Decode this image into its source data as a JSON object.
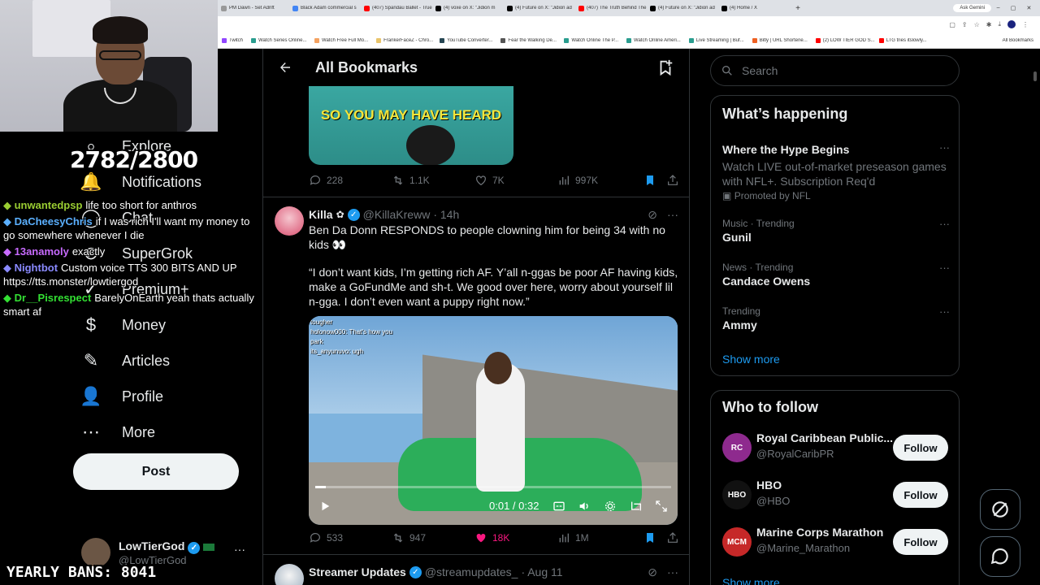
{
  "browser": {
    "tabs": [
      {
        "label": "PM Dawn - Set Adrift",
        "color": "#999"
      },
      {
        "label": "Black Adam commercial s",
        "color": "#4285f4"
      },
      {
        "label": "(407) Spandau Ballet - True",
        "color": "#ff0000"
      },
      {
        "label": "(4) voxe on X: \"Jidion m",
        "color": "#000000"
      },
      {
        "label": "(4) Future on X: \"Jidion ad",
        "color": "#000000"
      },
      {
        "label": "(407) The Truth Behind The",
        "color": "#ff0000"
      },
      {
        "label": "(4) Future on X: \"Jidion ad",
        "color": "#000000"
      },
      {
        "label": "(4) Home / X",
        "color": "#000000"
      }
    ],
    "new_tab": "+",
    "gemini": "Ask Gemini",
    "bookmarks": [
      {
        "label": "Twitch",
        "color": "#9146ff"
      },
      {
        "label": "Watch Series Online...",
        "color": "#2a9d8f"
      },
      {
        "label": "Watch Free Full Mo...",
        "color": "#f4a261"
      },
      {
        "label": "FrankerFaceZ - Chro...",
        "color": "#e9c46a"
      },
      {
        "label": "YouTube Converter...",
        "color": "#264653"
      },
      {
        "label": "Fear the Walking De...",
        "color": "#555555"
      },
      {
        "label": "Watch Online The P...",
        "color": "#2a9d8f"
      },
      {
        "label": "Watch Online Ameri...",
        "color": "#2a9d8f"
      },
      {
        "label": "Live Streaming | Buf...",
        "color": "#2a9d8f"
      },
      {
        "label": "Bitly | URL Shortene...",
        "color": "#ee6123"
      },
      {
        "label": "(2) LOW TIER GOD S...",
        "color": "#ff0000"
      },
      {
        "label": "LTG tries itslowly...",
        "color": "#ff0000"
      }
    ],
    "all_bookmarks": "All Bookmarks"
  },
  "nav": {
    "items": [
      {
        "label": "Explore",
        "icon": "search-icon",
        "glyph": "⌕"
      },
      {
        "label": "Notifications",
        "icon": "bell-icon",
        "glyph": "🔔"
      },
      {
        "label": "Chat",
        "icon": "chat-icon",
        "glyph": "◯"
      },
      {
        "label": "SuperGrok",
        "icon": "grok-icon",
        "glyph": "⊘"
      },
      {
        "label": "Premium+",
        "icon": "premium-icon",
        "glyph": "✓"
      },
      {
        "label": "Money",
        "icon": "money-icon",
        "glyph": "$"
      },
      {
        "label": "Articles",
        "icon": "articles-icon",
        "glyph": "✎"
      },
      {
        "label": "Profile",
        "icon": "profile-icon",
        "glyph": "👤"
      },
      {
        "label": "More",
        "icon": "more-icon",
        "glyph": "⋯"
      }
    ],
    "post_label": "Post",
    "account": {
      "name": "LowTierGod",
      "handle": "@LowTierGod",
      "more": "···"
    }
  },
  "overlay": {
    "counter": "2782/2800",
    "bans": "YEARLY BANS: 8041",
    "chat": [
      {
        "user": "unwantedpsp",
        "color": "#9acd32",
        "text": "life too short for anthros"
      },
      {
        "user": "DaCheesyChris",
        "color": "#5bb0ff",
        "text": "if I was rich I'll want my money to go somewhere whenever I die"
      },
      {
        "user": "13anamoly",
        "color": "#c86bff",
        "text": "exactly"
      },
      {
        "user": "Nightbot",
        "color": "#8a8aff",
        "text": "Custom voice TTS 300 BITS AND UP https://tts.monster/lowtiergod"
      },
      {
        "user": "Dr__Pisrespect",
        "color": "#33e033",
        "text": "BarelyOnEarth yeah thats actually smart af"
      }
    ]
  },
  "main": {
    "title": "All Bookmarks",
    "post1": {
      "thumb_text": "SO YOU MAY HAVE HEARD",
      "replies": "228",
      "reposts": "1.1K",
      "likes": "7K",
      "views": "997K"
    },
    "post2": {
      "name": "Killa",
      "handle": "@KillaKreww",
      "time": "· 14h",
      "text1": "Ben Da Donn RESPONDS to people clowning him for being 34 with no kids 👀",
      "text2": "“I don’t want kids, I’m getting rich AF. Y’all n-ggas be poor AF having kids, make a GoFundMe and sh-t. We good over here, worry about yourself lil n-gga. I don’t even want a puppy right now.”",
      "video_chat": [
        "tougher",
        "holonow000: That's how you",
        "park",
        "its_anyunuvo: ugh"
      ],
      "video_time": "0:01 / 0:32",
      "video_progress": 0.03,
      "replies": "533",
      "reposts": "947",
      "likes": "18K",
      "views": "1M"
    },
    "post3": {
      "name": "Streamer Updates",
      "handle": "@streamupdates_",
      "time": "· Aug 11"
    }
  },
  "right": {
    "search_placeholder": "Search",
    "happening_title": "What’s happening",
    "promo": {
      "name": "Where the Hype Begins",
      "desc": "Watch LIVE out-of-market preseason games with NFL+. Subscription Req'd",
      "by": "Promoted by NFL"
    },
    "trends": [
      {
        "meta": "Music · Trending",
        "name": "Gunil"
      },
      {
        "meta": "News · Trending",
        "name": "Candace Owens"
      },
      {
        "meta": "Trending",
        "name": "Ammy"
      }
    ],
    "show_more": "Show more",
    "wtf_title": "Who to follow",
    "follow_label": "Follow",
    "wtf": [
      {
        "name": "Royal Caribbean Public...",
        "handle": "@RoyalCaribPR",
        "color": "#8e2a8e",
        "initials": "RC"
      },
      {
        "name": "HBO",
        "handle": "@HBO",
        "color": "#111111",
        "initials": "HBO"
      },
      {
        "name": "Marine Corps Marathon",
        "handle": "@Marine_Marathon",
        "color": "#c62828",
        "initials": "MCM"
      }
    ],
    "show_more_2": "Show more"
  }
}
